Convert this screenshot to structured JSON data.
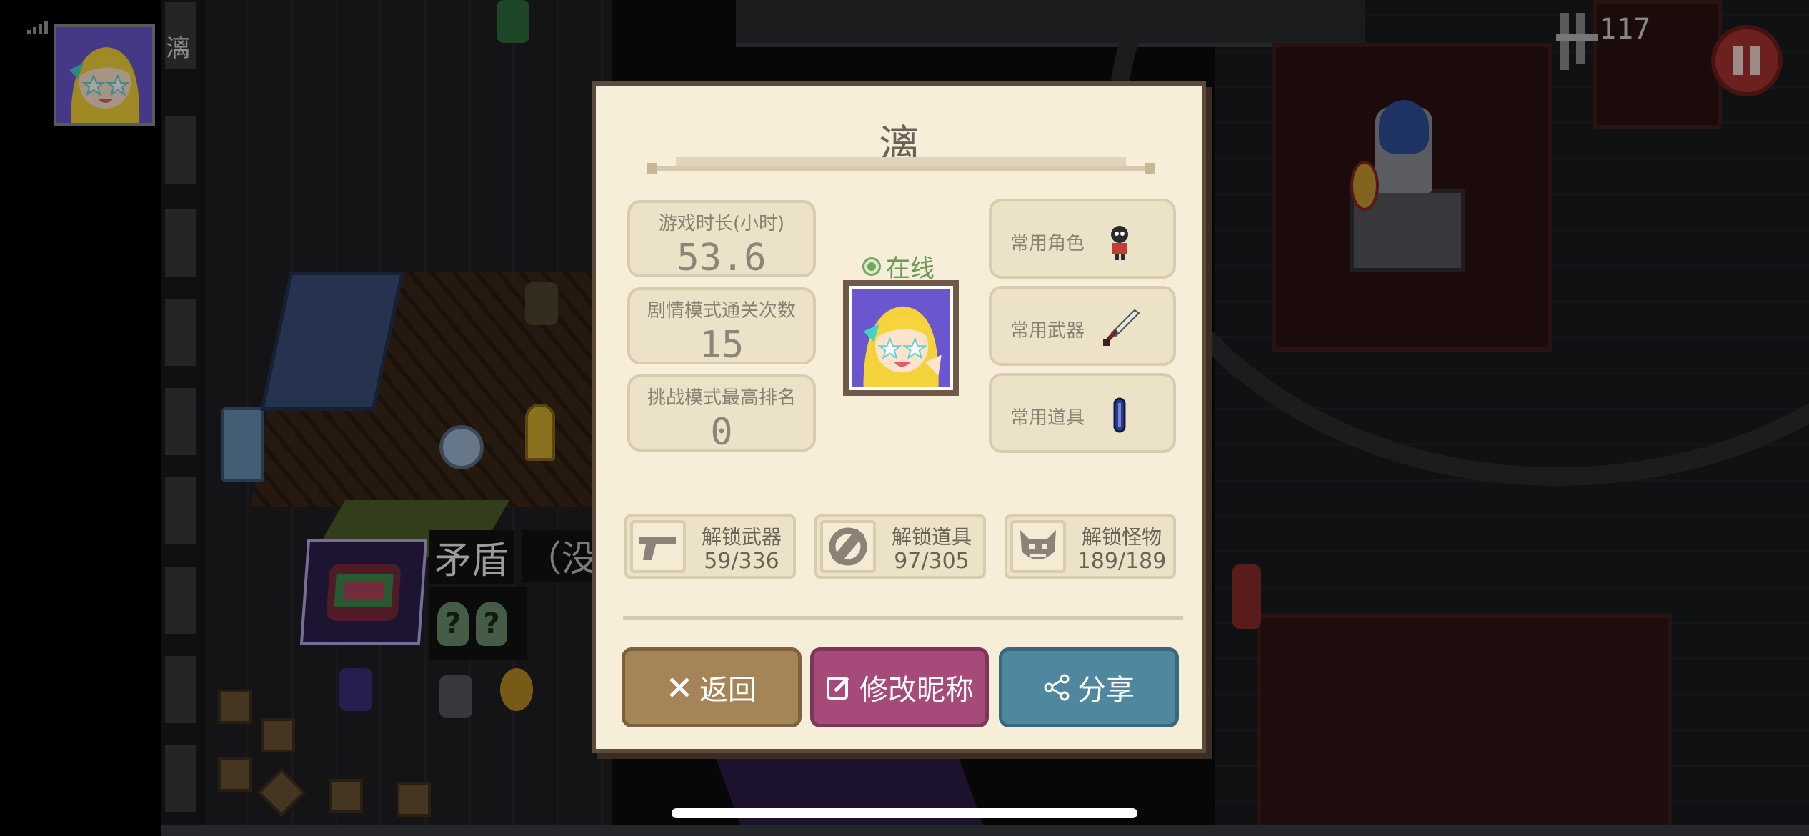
{
  "status": {
    "signal": "signal-bars"
  },
  "player_hud": {
    "name": "漓",
    "coin_count": "117"
  },
  "weapon_hud": {
    "name": "矛盾",
    "note": "（没有"
  },
  "profile": {
    "title": "漓",
    "stats": [
      {
        "label": "游戏时长(小时)",
        "value": "53.6"
      },
      {
        "label": "剧情模式通关次数",
        "value": "15"
      },
      {
        "label": "挑战模式最高排名",
        "value": "0"
      }
    ],
    "status_text": "在线",
    "favorites": [
      {
        "label": "常用角色",
        "icon": "character-icon"
      },
      {
        "label": "常用武器",
        "icon": "sword-icon"
      },
      {
        "label": "常用道具",
        "icon": "item-icon"
      }
    ],
    "unlocks": [
      {
        "label": "解锁武器",
        "value": "59/336",
        "icon": "pistol-icon"
      },
      {
        "label": "解锁道具",
        "value": "97/305",
        "icon": "ring-item-icon"
      },
      {
        "label": "解锁怪物",
        "value": "189/189",
        "icon": "monster-icon"
      }
    ],
    "buttons": {
      "back": "返回",
      "rename": "修改昵称",
      "share": "分享"
    }
  },
  "colors": {
    "dialog_bg": "#f7eed9",
    "back_btn": "#a58457",
    "rename_btn": "#a64a7a",
    "share_btn": "#4f879e",
    "online_green": "#6a9a57",
    "pause_red": "#a8332f"
  }
}
